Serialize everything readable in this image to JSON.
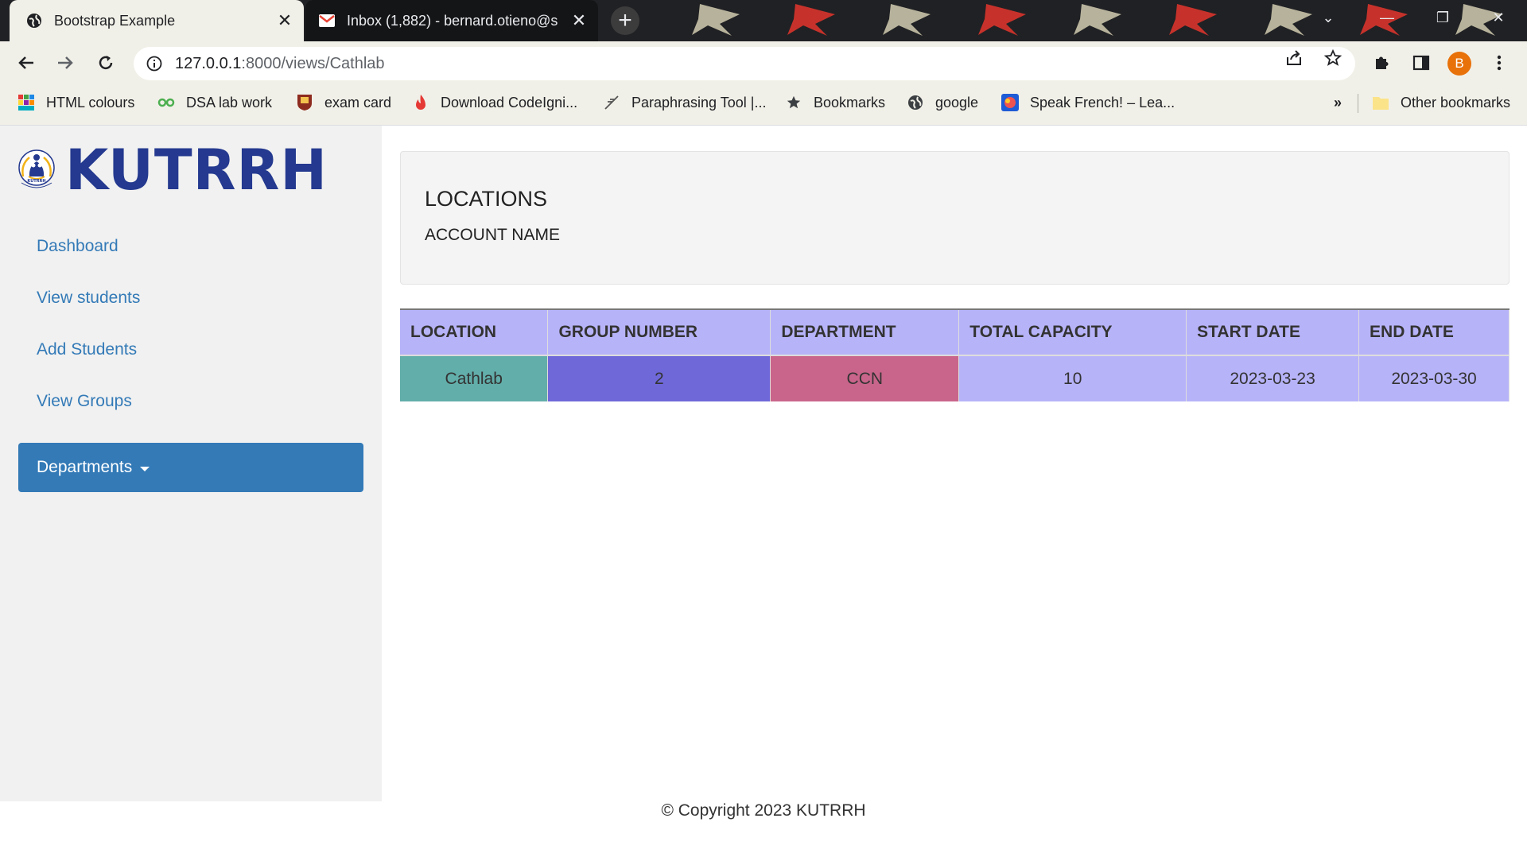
{
  "browser": {
    "tabs": [
      {
        "title": "Bootstrap Example",
        "active": true
      },
      {
        "title": "Inbox (1,882) - bernard.otieno@s",
        "active": false
      }
    ],
    "url_host": "127.0.0.1",
    "url_path": ":8000/views/Cathlab",
    "avatar_letter": "B",
    "bookmarks": [
      {
        "label": "HTML colours",
        "icon": "grid-icon"
      },
      {
        "label": "DSA lab work",
        "icon": "link-icon"
      },
      {
        "label": "exam card",
        "icon": "crest-icon"
      },
      {
        "label": "Download CodeIgni...",
        "icon": "flame-icon"
      },
      {
        "label": "Paraphrasing Tool |...",
        "icon": "feather-icon"
      },
      {
        "label": "Bookmarks",
        "icon": "star-icon"
      },
      {
        "label": "google",
        "icon": "globe-icon"
      },
      {
        "label": "Speak French! – Lea...",
        "icon": "flag-icon"
      }
    ],
    "overflow_label": "»",
    "other_bookmarks": "Other bookmarks"
  },
  "sidebar": {
    "brand": "KUTRRH",
    "logo_text": "KUTRRH",
    "items": [
      "Dashboard",
      "View students",
      "Add Students",
      "View Groups"
    ],
    "dropdown_label": "Departments"
  },
  "main": {
    "heading": "LOCATIONS",
    "subheading": "ACCOUNT NAME",
    "table": {
      "headers": [
        "LOCATION",
        "GROUP NUMBER",
        "DEPARTMENT",
        "TOTAL CAPACITY",
        "START DATE",
        "END DATE"
      ],
      "rows": [
        [
          "Cathlab",
          "2",
          "CCN",
          "10",
          "2023-03-23",
          "2023-03-30"
        ]
      ]
    }
  },
  "footer": "© Copyright 2023 KUTRRH",
  "colors": {
    "brand": "#24398f",
    "link": "#337ab7",
    "header_bg": "#b7b3f9",
    "location_cell": "#62aeaa",
    "group_cell": "#6f68d9",
    "department_cell": "#c9658a"
  }
}
